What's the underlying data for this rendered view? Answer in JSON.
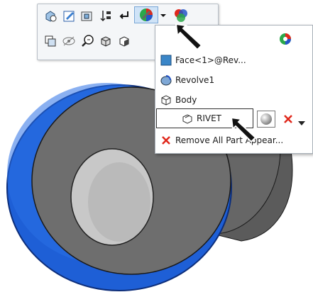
{
  "colors": {
    "wheel_blue": "#1e5fd6",
    "face_gray": "#6e6e6e",
    "hub_light": "#c8c8c8",
    "menu_border": "#a8b0b8",
    "remove_x": "#e0281c"
  },
  "toolbar": {
    "row1_icons": [
      "zoom-to-selection-icon",
      "edit-sketch-icon",
      "edit-feature-icon",
      "sort-icon",
      "return-icon",
      "appearance-icon",
      "dropdown-arrow-icon",
      "appearance-palette-icon"
    ],
    "row2_icons": [
      "selection-filter-icon",
      "hide-icon",
      "zoom-to-fit-icon",
      "display-style-icon",
      "view-orientation-icon"
    ]
  },
  "menu": {
    "header_icon": "color-wheel-icon",
    "items": [
      {
        "label": "Face<1>@Rev...",
        "icon": "face-icon"
      },
      {
        "label": "Revolve1",
        "icon": "revolve-icon"
      },
      {
        "label": "Body",
        "icon": "body-icon"
      },
      {
        "label": "RIVET",
        "icon": "part-icon"
      },
      {
        "label": "Remove All Part Appear...",
        "icon": "remove-x-icon"
      }
    ],
    "rivet_controls": [
      "sphere-preview-icon",
      "remove-x-icon",
      "dropdown-arrow-icon"
    ]
  }
}
